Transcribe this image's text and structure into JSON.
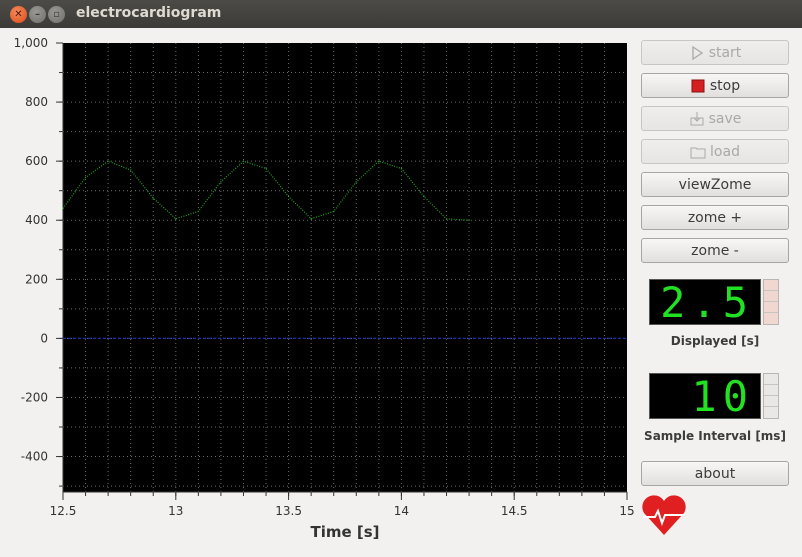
{
  "window": {
    "title": "electrocardiogram"
  },
  "controls": {
    "start": "start",
    "stop": "stop",
    "save": "save",
    "load": "load",
    "view_zome": "viewZome",
    "zome_plus": "zome +",
    "zome_minus": "zome -",
    "about": "about"
  },
  "displays": {
    "displayed_value": "2.5",
    "displayed_label": "Displayed [s]",
    "sample_interval_value": "10",
    "sample_interval_label": "Sample Interval [ms]"
  },
  "colors": {
    "signal": "#1fa51f",
    "baseline": "#1c2eaa",
    "lcd_digits": "#22e022",
    "plot_bg": "#000000"
  },
  "chart_data": {
    "type": "line",
    "xlabel": "Time [s]",
    "ylabel": "",
    "xlim": [
      12.5,
      15
    ],
    "ylim": [
      -520,
      1000
    ],
    "x_ticks": [
      "12.5",
      "13",
      "13.5",
      "14",
      "14.5",
      "15"
    ],
    "y_ticks": [
      "1,000",
      "800",
      "600",
      "400",
      "200",
      "0",
      "-200",
      "-400"
    ],
    "grid": true,
    "series": [
      {
        "x": [
          12.5,
          12.6,
          12.7,
          12.8,
          12.9,
          13.0,
          13.1,
          13.2,
          13.3,
          13.4,
          13.5,
          13.6,
          13.7,
          13.8,
          13.9,
          14.0,
          14.1,
          14.2,
          14.3
        ],
        "values": [
          440,
          545,
          600,
          570,
          475,
          405,
          430,
          530,
          600,
          575,
          480,
          405,
          430,
          530,
          600,
          575,
          480,
          405,
          400
        ]
      },
      {
        "x": [
          12.5,
          15
        ],
        "values": [
          0,
          0
        ]
      }
    ]
  }
}
